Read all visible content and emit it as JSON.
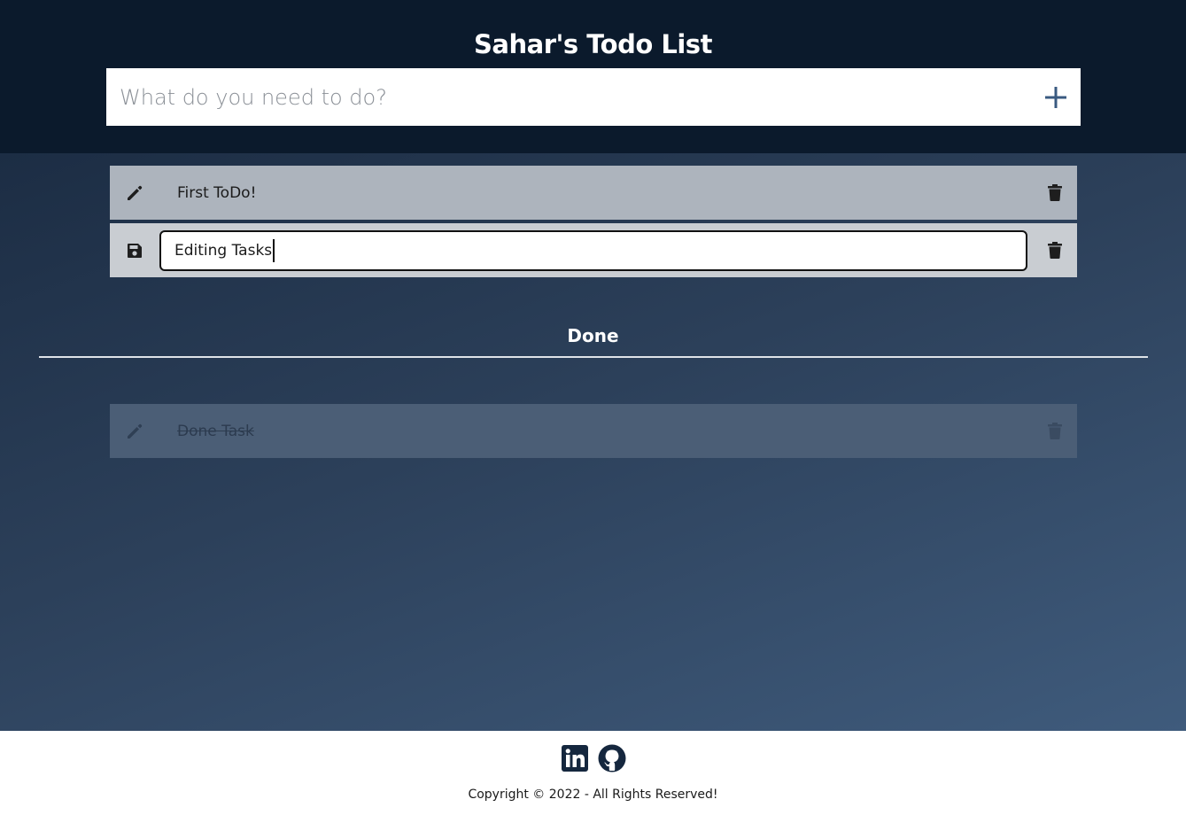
{
  "header": {
    "title": "Sahar's Todo List",
    "input_placeholder": "What do you need to do?",
    "add_icon": "plus-icon"
  },
  "todos": [
    {
      "text": "First ToDo!",
      "state": "normal",
      "left_icon": "pencil-icon",
      "right_icon": "trash-icon"
    },
    {
      "text": "Editing Tasks",
      "state": "editing",
      "left_icon": "save-icon",
      "right_icon": "trash-icon"
    }
  ],
  "done": {
    "heading": "Done",
    "items": [
      {
        "text": "Done Task",
        "state": "done",
        "left_icon": "pencil-icon",
        "right_icon": "trash-icon"
      }
    ]
  },
  "footer": {
    "links": [
      {
        "icon": "linkedin-icon"
      },
      {
        "icon": "github-icon"
      }
    ],
    "copyright": "Copyright © 2022 - All Rights Reserved!"
  },
  "colors": {
    "header_bg": "#0b1a2c",
    "accent": "#3a5a80",
    "item_bg": "#adb4bd",
    "done_item_bg": "#4b5e76"
  }
}
